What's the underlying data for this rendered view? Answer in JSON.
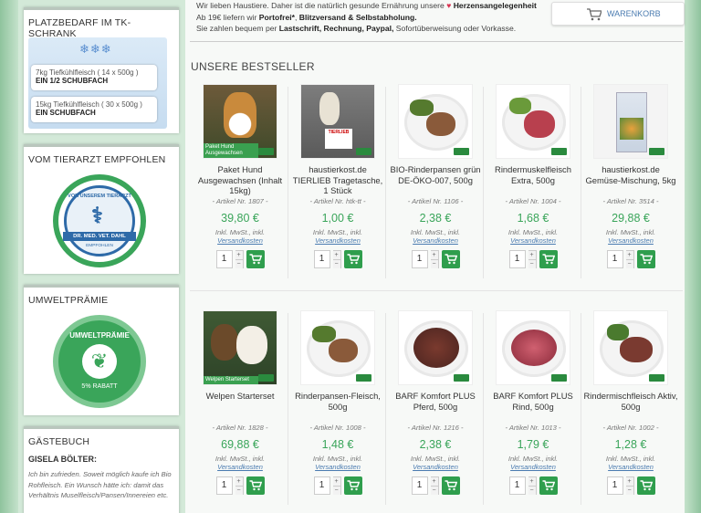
{
  "colors": {
    "accent": "#3aa55a",
    "heart": "#d9304f",
    "link": "#4a7bb0"
  },
  "intro": {
    "line1_pre": "Wir lieben Haustiere. Daher ist die natürlich gesunde Ernährung unsere",
    "line1_bold": "Herzensangelegenheit",
    "line2_pre": "Ab 19€ liefern wir",
    "line2_bold1": "Portofrei*",
    "line2_bold2": "Blitzversand & Selbstabholung.",
    "line3_pre": "Sie zahlen bequem per",
    "line3_bold": "Lastschrift, Rechnung, Paypal,",
    "line3_post": "Sofortüberweisung oder Vorkasse."
  },
  "cart": {
    "label": "WARENKORB",
    "icon": "cart-icon"
  },
  "sidebar": {
    "platz": {
      "title": "PLATZBEDARF IM TK-SCHRANK",
      "icon": "snowflake-icon",
      "items": [
        {
          "line": "7kg Tiefkühlfleisch ( 14 x 500g )",
          "bold": "EIN 1/2 SCHUBFACH"
        },
        {
          "line": "15kg Tiefkühlfleisch ( 30 x 500g )",
          "bold": "EIN SCHUBFACH"
        }
      ]
    },
    "tierarzt": {
      "title": "VOM TIERARZT EMPFOHLEN",
      "arc_top": "VON UNSEREM TIERARZT",
      "name": "DR. MED. VET. DAHL",
      "sub": "EMPFOHLEN"
    },
    "umwelt": {
      "title": "UMWELTPRÄMIE",
      "arc_top": "UMWELTPRÄMIE",
      "arc_bottom": "5% RABATT"
    },
    "guestbook": {
      "title": "GÄSTEBUCH",
      "author": "GISELA BÖLTER:",
      "text": "Ich bin zufrieden. Soweit möglich kaufe ich Bio Rohfleisch. Ein Wunsch hätte ich: damit das Verhältnis Muselfleisch/Pansen/Innereien etc."
    }
  },
  "bestseller_title": "UNSERE BESTSELLER",
  "common": {
    "inkl": "Inkl. MwSt., inkl.",
    "versand": "Versandkosten",
    "qty": "1"
  },
  "products": [
    {
      "name": "Paket Hund Ausgewachsen (Inhalt 15kg)",
      "art": "- Artikel Nr. 1807 -",
      "price": "39,80 €",
      "img": "dog",
      "label": "Paket Hund Ausgewachsen"
    },
    {
      "name": "haustierkost.de TIERLIEB Tragetasche, 1 Stück",
      "art": "- Artikel Nr. htk-tt -",
      "price": "1,00 €",
      "img": "bag",
      "label": "TIERLIEB"
    },
    {
      "name": "BIO-Rinderpansen grün DE-ÖKO-007, 500g",
      "art": "- Artikel Nr. 1106 -",
      "price": "2,38 €",
      "img": "plate-brown",
      "label": ""
    },
    {
      "name": "Rindermuskelfleisch Extra, 500g",
      "art": "- Artikel Nr. 1004 -",
      "price": "1,68 €",
      "img": "plate-red",
      "label": ""
    },
    {
      "name": "haustierkost.de Gemüse-Mischung, 5kg",
      "art": "- Artikel Nr. 3514 -",
      "price": "29,88 €",
      "img": "bag-veg",
      "label": ""
    },
    {
      "name": "Welpen Starterset",
      "art": "- Artikel Nr. 1828 -",
      "price": "69,88 €",
      "img": "puppies",
      "label": "Welpen Starterset"
    },
    {
      "name": "Rinderpansen-Fleisch, 500g",
      "art": "- Artikel Nr. 1008 -",
      "price": "1,48 €",
      "img": "plate-brown",
      "label": ""
    },
    {
      "name": "BARF Komfort PLUS Pferd, 500g",
      "art": "- Artikel Nr. 1216 -",
      "price": "2,38 €",
      "img": "mince-dark",
      "label": ""
    },
    {
      "name": "BARF Komfort PLUS Rind, 500g",
      "art": "- Artikel Nr. 1013 -",
      "price": "1,79 €",
      "img": "mince-red",
      "label": ""
    },
    {
      "name": "Rindermischfleisch Aktiv, 500g",
      "art": "- Artikel Nr. 1002 -",
      "price": "1,28 €",
      "img": "plate-mix",
      "label": ""
    }
  ]
}
